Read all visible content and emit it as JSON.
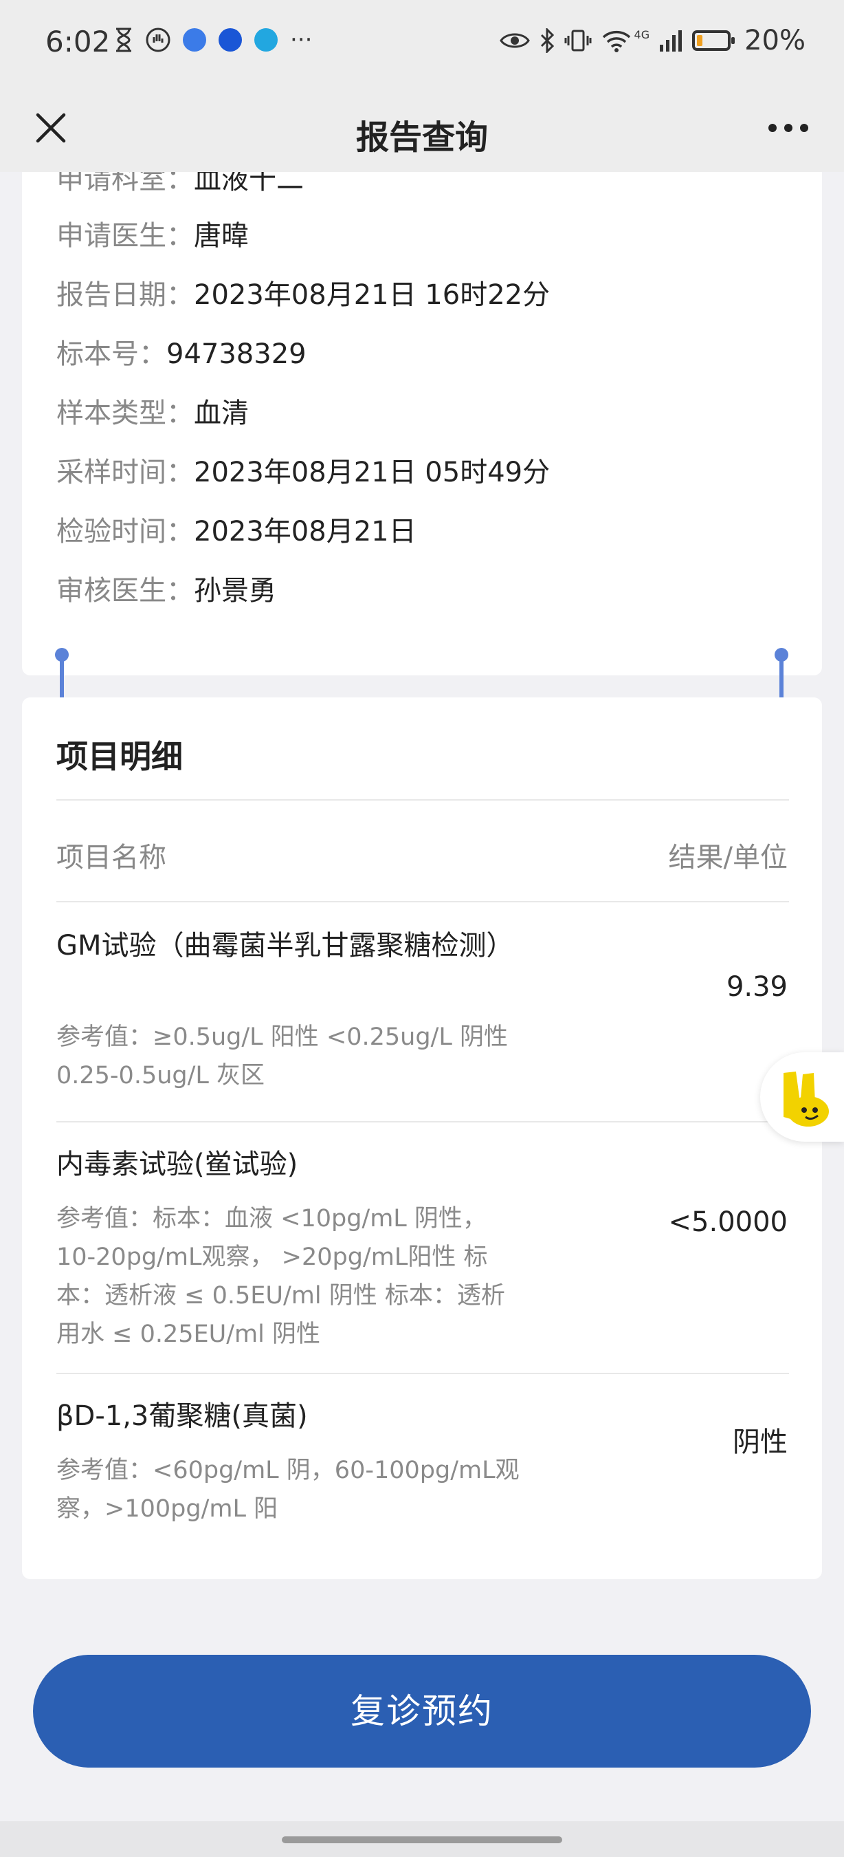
{
  "status_bar": {
    "time": "6:02",
    "battery_text": "20%",
    "battery_level": 0.2,
    "network_label": "4G",
    "left_icons": [
      "hourglass-icon",
      "hand-icon",
      "app-icon-1",
      "app-icon-2",
      "app-icon-3",
      "more-dots-icon"
    ],
    "right_icons": [
      "eye-icon",
      "bluetooth-icon",
      "vibrate-icon",
      "wifi-icon",
      "signal-icon",
      "battery-icon"
    ]
  },
  "nav": {
    "title": "报告查询",
    "close_icon": "close-icon",
    "more_icon": "more-icon"
  },
  "info": {
    "cut_row": {
      "label": "申请科室：",
      "value": "血液十二"
    },
    "rows": [
      {
        "label": "申请医生：",
        "value": "唐暐"
      },
      {
        "label": "报告日期：",
        "value": "2023年08月21日 16时22分"
      },
      {
        "label": "标本号：",
        "value": "94738329"
      },
      {
        "label": "样本类型：",
        "value": "血清"
      },
      {
        "label": "采样时间：",
        "value": "2023年08月21日 05时49分"
      },
      {
        "label": "检验时间：",
        "value": "2023年08月21日"
      },
      {
        "label": "审核医生：",
        "value": "孙景勇"
      }
    ]
  },
  "detail": {
    "title": "项目明细",
    "col_name": "项目名称",
    "col_result": "结果/单位",
    "items": [
      {
        "name": "GM试验（曲霉菌半乳甘露聚糖检测）",
        "ref": "参考值：≥0.5ug/L 阳性 <0.25ug/L 阴性 0.25-0.5ug/L 灰区",
        "result": "9.39"
      },
      {
        "name": "内毒素试验(鲎试验)",
        "ref": "参考值：标本：血液 <10pg/mL 阴性，10-20pg/mL观察， >20pg/mL阳性 标本：透析液 ≤ 0.5EU/ml 阴性 标本：透析用水 ≤ 0.25EU/ml 阴性",
        "result": "<5.0000"
      },
      {
        "name": "βD-1,3葡聚糖(真菌)",
        "ref": "参考值：<60pg/mL 阴，60-100pg/mL观察，>100pg/mL 阳",
        "result": "阴性"
      }
    ]
  },
  "button": {
    "label": "复诊预约"
  },
  "colors": {
    "accent": "#2b5fb3",
    "background": "#f1f1f4",
    "card": "#ffffff",
    "selection": "#5b82d8"
  }
}
